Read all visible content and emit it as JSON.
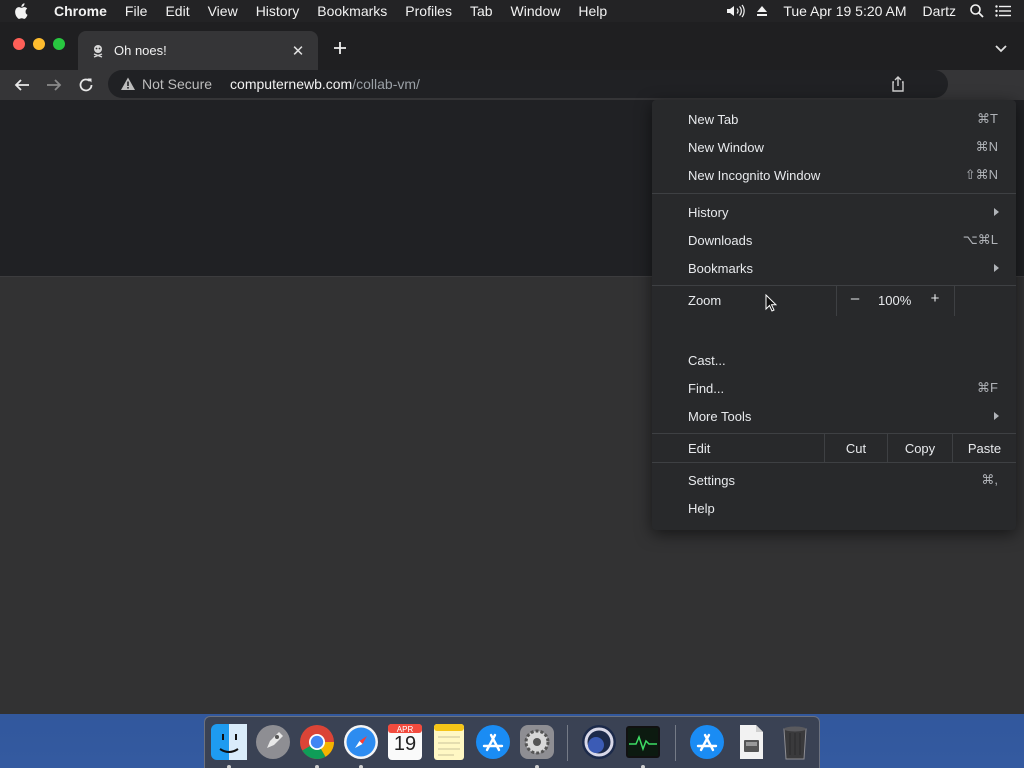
{
  "menubar": {
    "app_name": "Chrome",
    "menus": [
      "File",
      "Edit",
      "View",
      "History",
      "Bookmarks",
      "Profiles",
      "Tab",
      "Window",
      "Help"
    ],
    "clock": "Tue Apr 19  5:20 AM",
    "user": "Dartz",
    "icons": [
      "apple-icon",
      "volume-icon",
      "eject-icon",
      "spotlight-search-icon",
      "notification-center-icon"
    ]
  },
  "tab": {
    "title": "Oh noes!",
    "close_glyph": "✕"
  },
  "toolbar": {
    "security_label": "Not Secure",
    "url_host": "computernewb.com",
    "url_path": "/collab-vm/"
  },
  "app_menu": {
    "items": {
      "new_tab": {
        "label": "New Tab",
        "shortcut": "⌘T"
      },
      "new_window": {
        "label": "New Window",
        "shortcut": "⌘N"
      },
      "new_incognito": {
        "label": "New Incognito Window",
        "shortcut": "⇧⌘N"
      },
      "history": {
        "label": "History"
      },
      "downloads": {
        "label": "Downloads",
        "shortcut": "⌥⌘L"
      },
      "bookmarks": {
        "label": "Bookmarks"
      },
      "cast": {
        "label": "Cast..."
      },
      "find": {
        "label": "Find...",
        "shortcut": "⌘F"
      },
      "more_tools": {
        "label": "More Tools"
      },
      "settings": {
        "label": "Settings",
        "shortcut": "⌘,"
      },
      "help": {
        "label": "Help"
      }
    },
    "zoom": {
      "label": "Zoom",
      "minus": "–",
      "level": "100%",
      "plus": "+"
    },
    "edit": {
      "label": "Edit",
      "cut": "Cut",
      "copy": "Copy",
      "paste": "Paste"
    }
  },
  "dock": {
    "apps": [
      "Finder",
      "Launchpad",
      "Google Chrome",
      "Safari",
      "Calendar",
      "Notes",
      "App Store",
      "System Preferences",
      "Cinema 4D",
      "Activity Monitor",
      "App Store Downloads",
      "Document",
      "Trash"
    ],
    "calendar": {
      "month": "APR",
      "day": "19"
    }
  },
  "colors": {
    "menu_bg": "#28292b",
    "tab_active": "#353537",
    "omnibox_bg": "#202124",
    "close": "#fe5f57",
    "minimize": "#febc2e",
    "maximize": "#28c840"
  }
}
